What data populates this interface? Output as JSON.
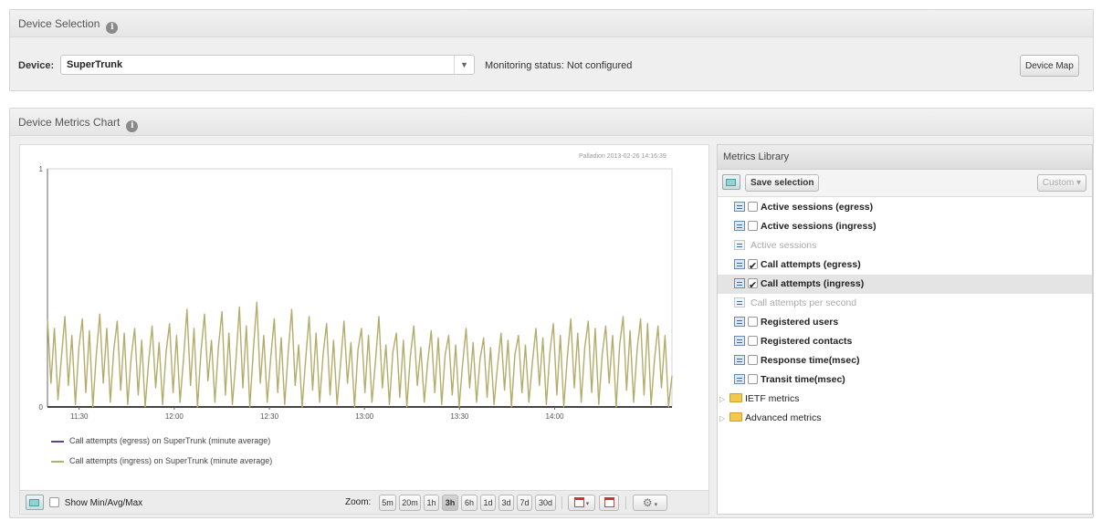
{
  "device_panel": {
    "title": "Device Selection",
    "device_label": "Device:",
    "device_value": "SuperTrunk",
    "monitoring_status": "Monitoring status: Not configured",
    "device_map_button": "Device Map"
  },
  "chart_panel": {
    "title": "Device Metrics Chart",
    "stamp": "Palladion 2013-02-26 14:16:39",
    "legend": [
      {
        "label": "Call attempts (egress) on SuperTrunk (minute average)",
        "color": "#4a4aa0"
      },
      {
        "label": "Call attempts (ingress) on SuperTrunk (minute average)",
        "color": "#b3ac6a"
      }
    ],
    "footer": {
      "show_minmax": "Show Min/Avg/Max",
      "zoom_label": "Zoom:",
      "zoom_options": [
        "5m",
        "20m",
        "1h",
        "3h",
        "6h",
        "1d",
        "3d",
        "7d",
        "30d"
      ],
      "zoom_active": "3h"
    }
  },
  "chart_data": {
    "type": "line",
    "x_ticks": [
      "11:30",
      "12:00",
      "12:30",
      "13:00",
      "13:30",
      "14:00"
    ],
    "x_range": [
      "11:20",
      "14:37"
    ],
    "ylim": [
      0,
      1
    ],
    "y_ticks": [
      "0",
      "1"
    ],
    "series": [
      {
        "name": "Call attempts (egress) on SuperTrunk (minute average)",
        "color": "#4a4aa0",
        "values": []
      },
      {
        "name": "Call attempts (ingress) on SuperTrunk (minute average)",
        "color": "#b3ac6a",
        "values": [
          0.37,
          0.1,
          0.33,
          0.03,
          0.21,
          0.38,
          0.09,
          0.3,
          0.01,
          0.25,
          0.37,
          0.06,
          0.32,
          0.0,
          0.22,
          0.39,
          0.1,
          0.33,
          0.02,
          0.24,
          0.36,
          0.07,
          0.31,
          0.01,
          0.21,
          0.33,
          0.05,
          0.28,
          0.0,
          0.19,
          0.34,
          0.08,
          0.27,
          0.01,
          0.23,
          0.35,
          0.06,
          0.3,
          0.02,
          0.2,
          0.41,
          0.09,
          0.33,
          0.0,
          0.23,
          0.39,
          0.11,
          0.28,
          0.02,
          0.25,
          0.4,
          0.05,
          0.31,
          0.01,
          0.19,
          0.42,
          0.08,
          0.34,
          0.0,
          0.24,
          0.44,
          0.1,
          0.3,
          0.02,
          0.21,
          0.37,
          0.06,
          0.29,
          0.01,
          0.23,
          0.41,
          0.09,
          0.26,
          0.0,
          0.2,
          0.38,
          0.07,
          0.31,
          0.02,
          0.22,
          0.35,
          0.05,
          0.28,
          0.01,
          0.18,
          0.36,
          0.1,
          0.27,
          0.0,
          0.24,
          0.33,
          0.06,
          0.3,
          0.02,
          0.19,
          0.38,
          0.08,
          0.26,
          0.01,
          0.23,
          0.31,
          0.04,
          0.28,
          0.0,
          0.21,
          0.34,
          0.09,
          0.25,
          0.02,
          0.19,
          0.32,
          0.06,
          0.29,
          0.01,
          0.22,
          0.3,
          0.05,
          0.26,
          0.0,
          0.18,
          0.33,
          0.08,
          0.27,
          0.02,
          0.2,
          0.29,
          0.04,
          0.25,
          0.01,
          0.17,
          0.31,
          0.07,
          0.28,
          0.0,
          0.22,
          0.3,
          0.06,
          0.26,
          0.02,
          0.19,
          0.33,
          0.09,
          0.29,
          0.01,
          0.23,
          0.35,
          0.05,
          0.3,
          0.0,
          0.21,
          0.37,
          0.08,
          0.31,
          0.02,
          0.25,
          0.36,
          0.06,
          0.33,
          0.01,
          0.22,
          0.34,
          0.1,
          0.3,
          0.0,
          0.26,
          0.38,
          0.07,
          0.32,
          0.02,
          0.24,
          0.37,
          0.05,
          0.35,
          0.01,
          0.2,
          0.34,
          0.08,
          0.3,
          0.0,
          0.13
        ]
      }
    ]
  },
  "metrics_library": {
    "title": "Metrics Library",
    "save_button": "Save selection",
    "custom_button": "Custom ▾",
    "items": [
      {
        "label": "Active sessions (egress)",
        "checkbox": true,
        "checked": false,
        "disabled": false,
        "selected": false
      },
      {
        "label": "Active sessions (ingress)",
        "checkbox": true,
        "checked": false,
        "disabled": false,
        "selected": false
      },
      {
        "label": "Active sessions",
        "checkbox": false,
        "checked": false,
        "disabled": true,
        "selected": false
      },
      {
        "label": "Call attempts (egress)",
        "checkbox": true,
        "checked": true,
        "disabled": false,
        "selected": false
      },
      {
        "label": "Call attempts (ingress)",
        "checkbox": true,
        "checked": true,
        "disabled": false,
        "selected": true
      },
      {
        "label": "Call attempts per second",
        "checkbox": false,
        "checked": false,
        "disabled": true,
        "selected": false
      },
      {
        "label": "Registered users",
        "checkbox": true,
        "checked": false,
        "disabled": false,
        "selected": false
      },
      {
        "label": "Registered contacts",
        "checkbox": true,
        "checked": false,
        "disabled": false,
        "selected": false
      },
      {
        "label": "Response time(msec)",
        "checkbox": true,
        "checked": false,
        "disabled": false,
        "selected": false
      },
      {
        "label": "Transit time(msec)",
        "checkbox": true,
        "checked": false,
        "disabled": false,
        "selected": false
      }
    ],
    "folders": [
      {
        "label": "IETF metrics"
      },
      {
        "label": "Advanced metrics"
      }
    ]
  }
}
